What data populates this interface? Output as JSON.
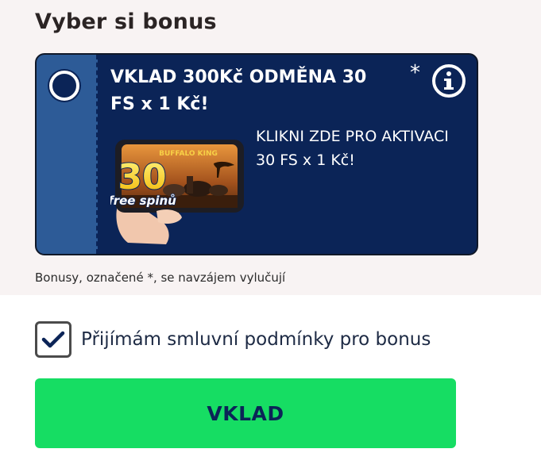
{
  "section": {
    "title": "Vyber si bonus"
  },
  "bonus_card": {
    "title": "VKLAD 300Kč ODMĚNA 30 FS x 1 Kč!",
    "asterisk": "*",
    "description": "KLIKNI ZDE PRO AKTIVACI 30 FS x 1 Kč!",
    "info_icon": "info-icon",
    "selected": false,
    "promo_image": {
      "badge_number": "30",
      "badge_text": "free spinů",
      "game_logo": "BUFFALO KING"
    }
  },
  "exclusive_note": "Bonusy, označené *, se navzájem vylučují",
  "terms": {
    "checked": true,
    "label": "Přijímám smluvní podmínky pro bonus"
  },
  "deposit_button": {
    "label": "VKLAD"
  },
  "colors": {
    "card_bg": "#0b2457",
    "card_stub": "#2d5b97",
    "button_bg": "#16dd63",
    "button_text": "#0b2457",
    "panel_bg": "#f8f3f3"
  }
}
